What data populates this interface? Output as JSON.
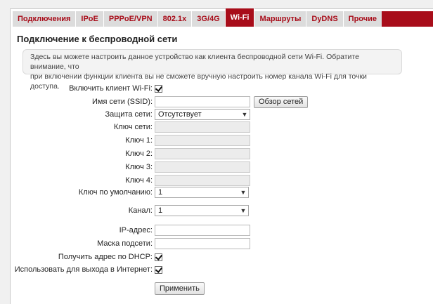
{
  "tabs": [
    {
      "label": "Подключения"
    },
    {
      "label": "IPoE"
    },
    {
      "label": "PPPoE/VPN"
    },
    {
      "label": "802.1x"
    },
    {
      "label": "3G/4G"
    },
    {
      "label": "Wi-Fi"
    },
    {
      "label": "Маршруты"
    },
    {
      "label": "DyDNS"
    },
    {
      "label": "Прочие"
    }
  ],
  "active_tab": "Wi-Fi",
  "page_title": "Подключение к беспроводной сети",
  "note": {
    "line1": "Здесь вы можете настроить данное устройство как клиента беспроводной сети Wi-Fi. Обратите внимание, что",
    "line2": "при включении функции клиента вы не сможете вручную настроить номер канала Wi-Fi для точки доступа."
  },
  "form": {
    "enable_client": {
      "label": "Включить клиент Wi-Fi:",
      "checked": true
    },
    "ssid": {
      "label": "Имя сети (SSID):",
      "value": ""
    },
    "scan_button": "Обзор сетей",
    "security": {
      "label": "Защита сети:",
      "value": "Отсутствует"
    },
    "network_key": {
      "label": "Ключ сети:",
      "value": ""
    },
    "key1": {
      "label": "Ключ 1:",
      "value": ""
    },
    "key2": {
      "label": "Ключ 2:",
      "value": ""
    },
    "key3": {
      "label": "Ключ 3:",
      "value": ""
    },
    "key4": {
      "label": "Ключ 4:",
      "value": ""
    },
    "default_key": {
      "label": "Ключ по умолчанию:",
      "value": "1"
    },
    "channel": {
      "label": "Канал:",
      "value": "1"
    },
    "ip_address": {
      "label": "IP-адрес:",
      "value": ""
    },
    "subnet_mask": {
      "label": "Маска подсети:",
      "value": ""
    },
    "dhcp": {
      "label": "Получить адрес по DHCP:",
      "checked": true
    },
    "internet": {
      "label": "Использовать для выхода в Интернет:",
      "checked": true
    },
    "apply_button": "Применить"
  },
  "colors": {
    "accent": "#a80d1a",
    "tab_bg": "#dcdcdc"
  }
}
